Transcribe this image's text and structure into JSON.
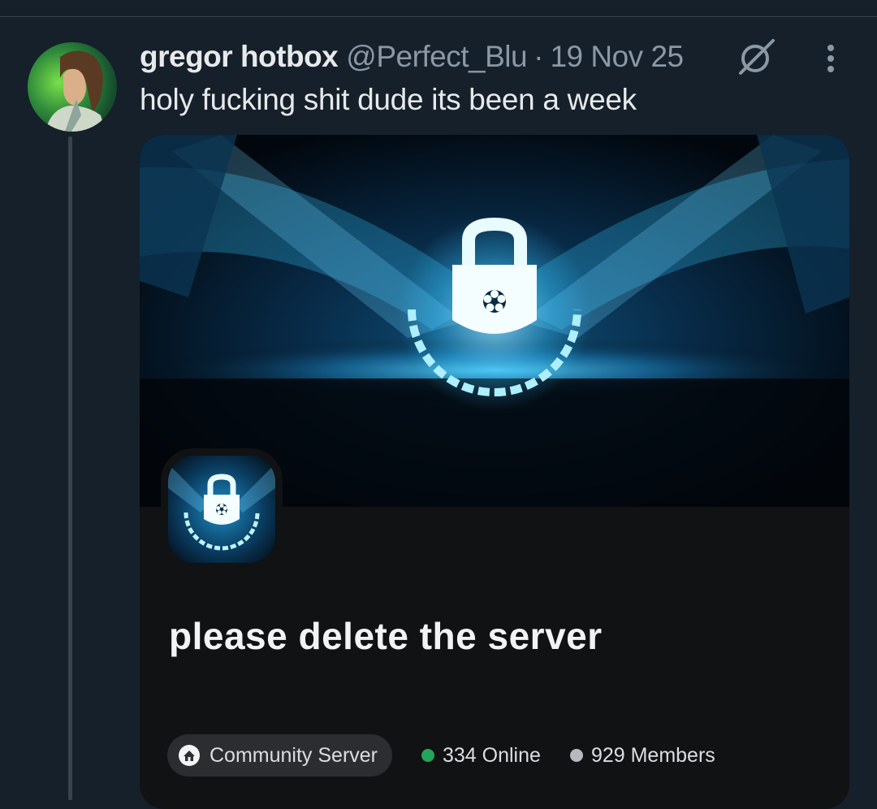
{
  "tweet": {
    "display_name": "gregor hotbox",
    "handle": "@Perfect_Blu",
    "separator": "·",
    "date": "19 Nov 25",
    "text": "holy fucking shit dude its been a week"
  },
  "card": {
    "server_name": "please delete the server",
    "community_label": "Community Server",
    "online": "334 Online",
    "members": "929 Members"
  },
  "colors": {
    "background": "#15202b",
    "online_dot": "#23a55a",
    "members_dot": "#b5bac1",
    "card_bg": "#111214"
  }
}
